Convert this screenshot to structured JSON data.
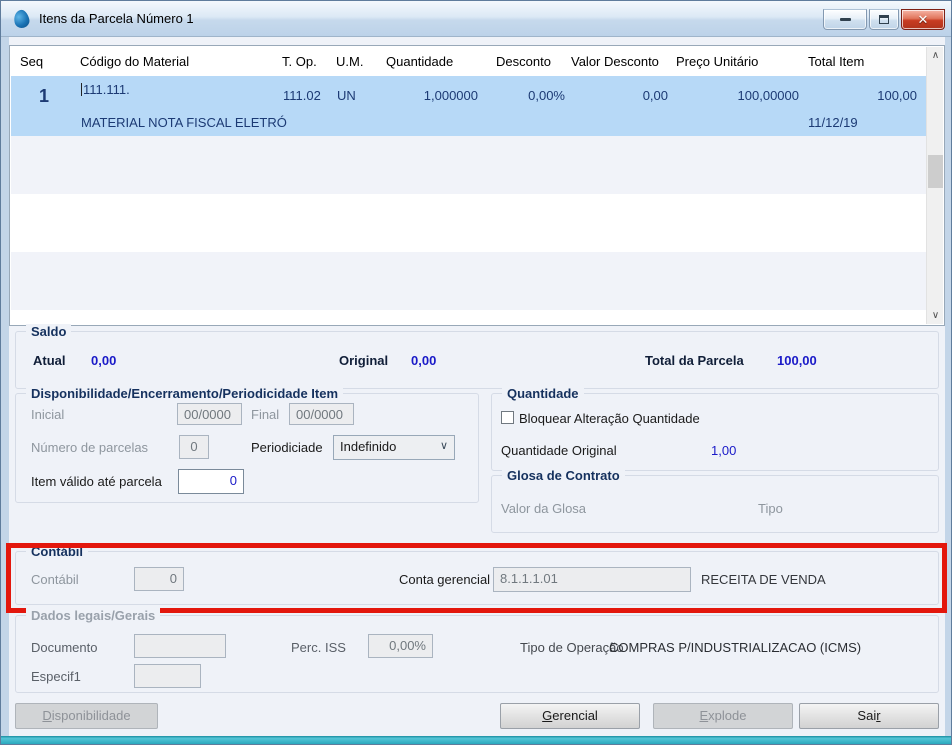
{
  "window": {
    "title": "Itens da Parcela Número 1"
  },
  "icons": {
    "close_glyph": "✕",
    "chevron_down": "∨",
    "scroll_up": "∧",
    "scroll_down": "∨"
  },
  "colors": {
    "selected_row": "#B7D9F7",
    "annotation_red": "#E3170D",
    "value_blue": "#1A1AC8"
  },
  "table": {
    "columns": [
      "Seq",
      "Código do Material",
      "T. Op.",
      "U.M.",
      "Quantidade",
      "Desconto",
      "Valor Desconto",
      "Preço Unitário",
      "Total Item"
    ],
    "row": {
      "seq": "1",
      "codigo": "111.111.",
      "t_op": "111.02",
      "um": "UN",
      "quantidade": "1,000000",
      "desconto": "0,00%",
      "valor_desconto": "0,00",
      "preco_unitario": "100,00000",
      "total_item": "100,00",
      "descricao": "MATERIAL NOTA FISCAL ELETRÓ",
      "data": "11/12/19"
    }
  },
  "saldo": {
    "title": "Saldo",
    "atual_label": "Atual",
    "atual_value": "0,00",
    "original_label": "Original",
    "original_value": "0,00",
    "total_label": "Total da Parcela",
    "total_value": "100,00"
  },
  "disp": {
    "title": "Disponibilidade/Encerramento/Periodicidade Item",
    "inicial_label": "Inicial",
    "inicial_value": "00/0000",
    "final_label": "Final",
    "final_value": "00/0000",
    "num_parcelas_label": "Número de parcelas",
    "num_parcelas_value": "0",
    "periodicidade_label": "Periodiciade",
    "periodicidade_value": "Indefinido",
    "item_valido_label": "Item válido até parcela",
    "item_valido_value": "0"
  },
  "quant": {
    "title": "Quantidade",
    "checkbox_label": "Bloquear Alteração Quantidade",
    "original_label": "Quantidade Original",
    "original_value": "1,00"
  },
  "glosa": {
    "title": "Glosa de Contrato",
    "valor_label": "Valor da Glosa",
    "tipo_label": "Tipo"
  },
  "contabil": {
    "title": "Contábil",
    "contabil_label": "Contábil",
    "contabil_value": "0",
    "conta_gerencial_label": "Conta gerencial",
    "conta_gerencial_value": "8.1.1.1.01",
    "conta_gerencial_desc": "RECEITA DE VENDA"
  },
  "dados": {
    "title": "Dados legais/Gerais",
    "documento_label": "Documento",
    "documento_value": "",
    "perc_iss_label": "Perc. ISS",
    "perc_iss_value": "0,00%",
    "tipo_operacao_label": "Tipo de Operação",
    "tipo_operacao_value": "COMPRAS P/INDUSTRIALIZACAO (ICMS)",
    "especif1_label": "Especif1",
    "especif1_value": ""
  },
  "buttons": {
    "disponibilidade": {
      "pre": "",
      "accel": "D",
      "post": "isponibilidade"
    },
    "gerencial": {
      "pre": "",
      "accel": "G",
      "post": "erencial"
    },
    "explode": {
      "pre": "",
      "accel": "E",
      "post": "xplode"
    },
    "sair": {
      "pre": "Sai",
      "accel": "r",
      "post": ""
    }
  }
}
